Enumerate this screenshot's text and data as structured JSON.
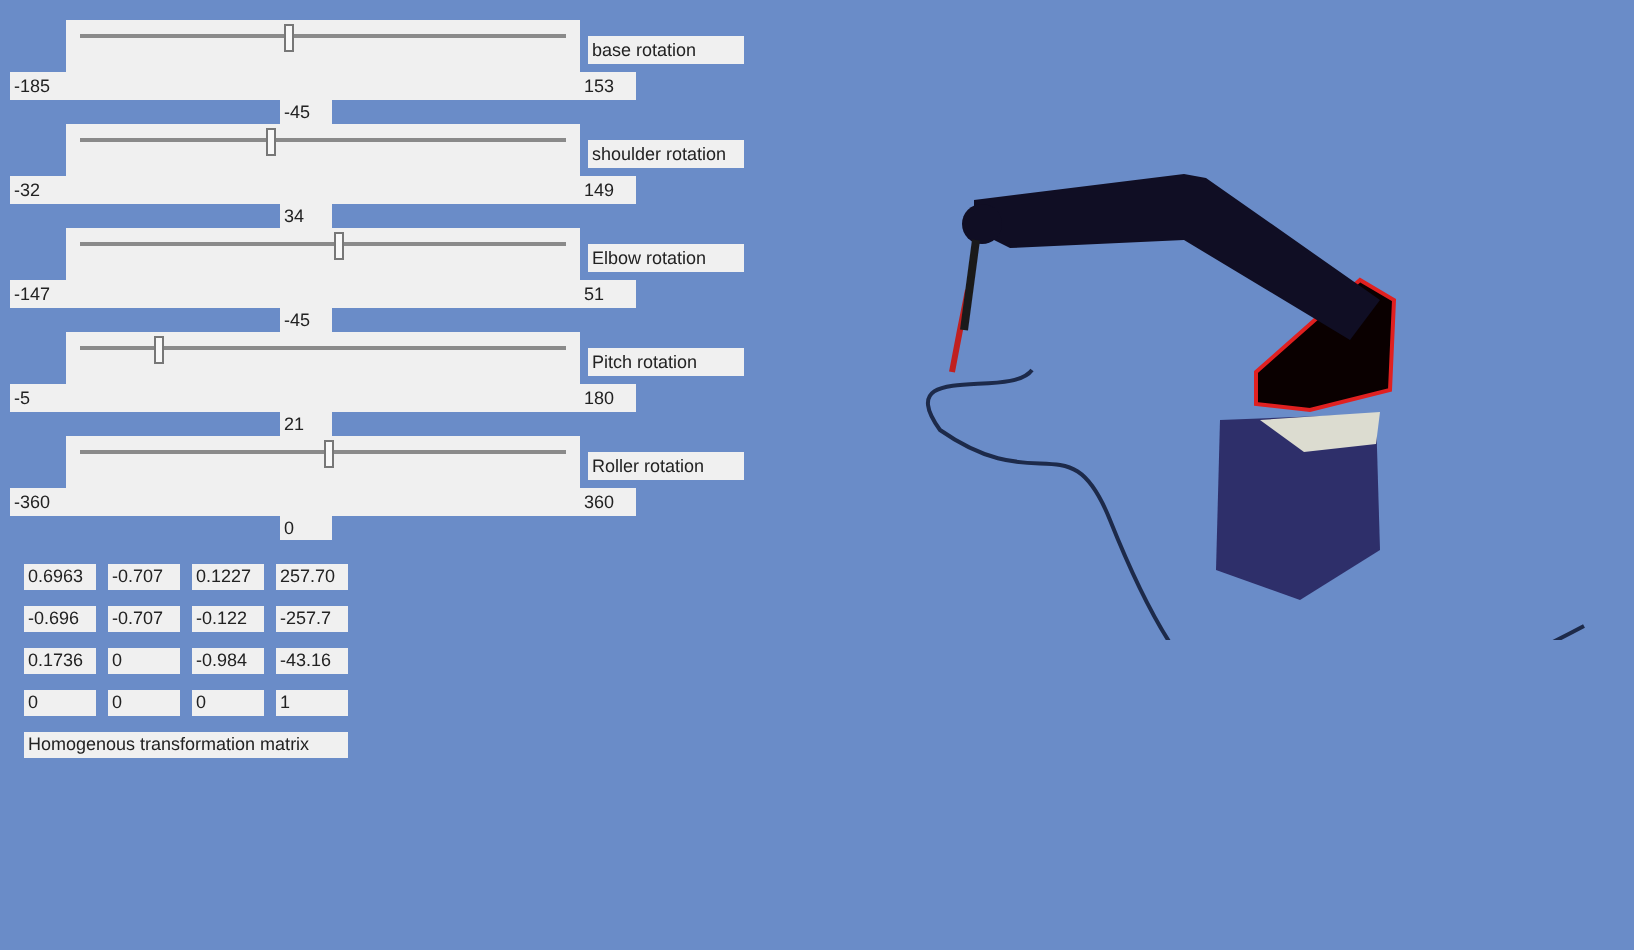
{
  "sliders": [
    {
      "label": "base rotation",
      "min": "-185",
      "max": "153",
      "value": "-45",
      "level": 0.43
    },
    {
      "label": "shoulder rotation",
      "min": "-32",
      "max": "149",
      "value": "34",
      "level": 0.39
    },
    {
      "label": "Elbow rotation",
      "min": "-147",
      "max": "51",
      "value": "-45",
      "level": 0.53
    },
    {
      "label": "Pitch rotation",
      "min": "-5",
      "max": "180",
      "value": "21",
      "level": 0.16
    },
    {
      "label": "Roller rotation",
      "min": "-360",
      "max": "360",
      "value": "0",
      "level": 0.51
    }
  ],
  "matrix": {
    "rows": [
      [
        "0.6963",
        "-0.707",
        "0.1227",
        "257.70"
      ],
      [
        "-0.696",
        "-0.707",
        "-0.122",
        "-257.7"
      ],
      [
        "0.1736",
        "0",
        "-0.984",
        "-43.16"
      ],
      [
        "0",
        "0",
        "0",
        "1"
      ]
    ],
    "caption": "Homogenous transformation matrix"
  }
}
